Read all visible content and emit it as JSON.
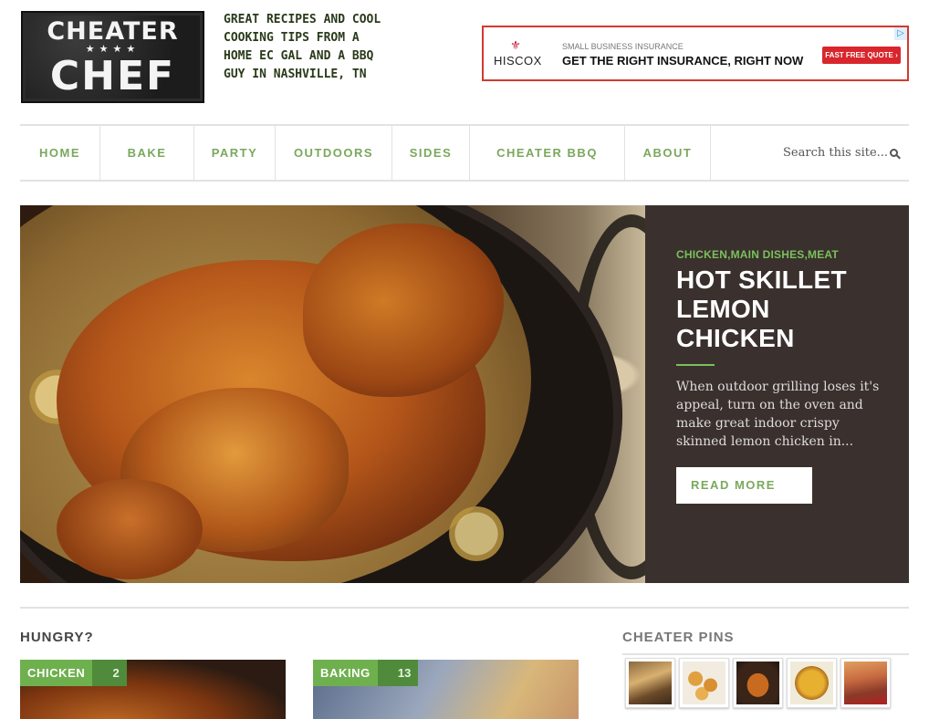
{
  "header": {
    "logo_top": "CHEATER",
    "logo_stars": "★★★★",
    "logo_bottom": "CHEF",
    "tagline": "GREAT RECIPES AND COOL COOKING TIPS FROM A HOME EC GAL AND A BBQ GUY IN NASHVILLE, TN"
  },
  "ad": {
    "brand": "HISCOX",
    "eyebrow": "SMALL BUSINESS INSURANCE",
    "headline": "GET THE RIGHT INSURANCE, RIGHT NOW",
    "cta": "FAST FREE QUOTE ›",
    "adchoices": "▷",
    "brand_color": "#c8102e"
  },
  "nav": {
    "items": [
      "HOME",
      "BAKE",
      "PARTY",
      "OUTDOORS",
      "SIDES",
      "CHEATER BBQ",
      "ABOUT"
    ],
    "search_placeholder": "Search this site...",
    "accent": "#7aa85c"
  },
  "hero": {
    "categories": "CHICKEN,MAIN DISHES,MEAT",
    "title": "HOT SKILLET LEMON CHICKEN",
    "excerpt": "When outdoor grilling loses it's appeal, turn on the oven and make great indoor crispy skinned lemon chicken in...",
    "read_more": "READ MORE",
    "panel_color": "#3a302d"
  },
  "hungry": {
    "title": "HUNGRY?",
    "cards": [
      {
        "label": "CHICKEN",
        "count": "2"
      },
      {
        "label": "BAKING",
        "count": "13"
      }
    ]
  },
  "pins": {
    "title": "CHEATER PINS",
    "thumbnails": [
      "pin-casserole-pans",
      "pin-fried-balls",
      "pin-roast-chicken",
      "pin-cheese-bake",
      "pin-lasagna"
    ]
  }
}
